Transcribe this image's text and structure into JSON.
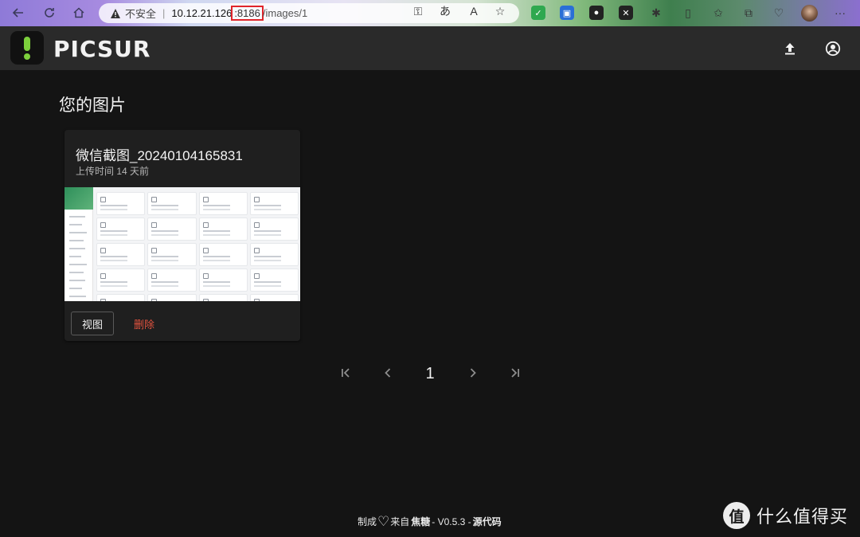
{
  "browser": {
    "security_warning": "不安全",
    "url_host": "10.12.21.126",
    "url_port": ":8186",
    "url_path": "/images/1"
  },
  "app": {
    "brand": "PICSUR"
  },
  "page": {
    "title": "您的图片"
  },
  "images": [
    {
      "name": "微信截图_20240104165831",
      "uploaded": "上传时间 14 天前",
      "view_label": "视图",
      "delete_label": "删除"
    }
  ],
  "pagination": {
    "first": "|‹",
    "prev": "‹",
    "current": "1",
    "next": "›",
    "last": "›|"
  },
  "footer": {
    "made_with": "制成",
    "from": "来自",
    "author": "焦糖",
    "version": "- V0.5.3 -",
    "source": "源代码"
  },
  "watermark": {
    "badge": "值",
    "text": "什么值得买"
  },
  "colors": {
    "accent_green": "#7ccf3c",
    "delete_red": "#e2533f",
    "background": "#141414",
    "header": "#2a2a2a",
    "card": "#1f1f1f"
  },
  "icons": {
    "back": "arrow-left-icon",
    "refresh": "refresh-icon",
    "home": "home-icon",
    "upload": "upload-icon",
    "account": "account-circle-icon"
  }
}
